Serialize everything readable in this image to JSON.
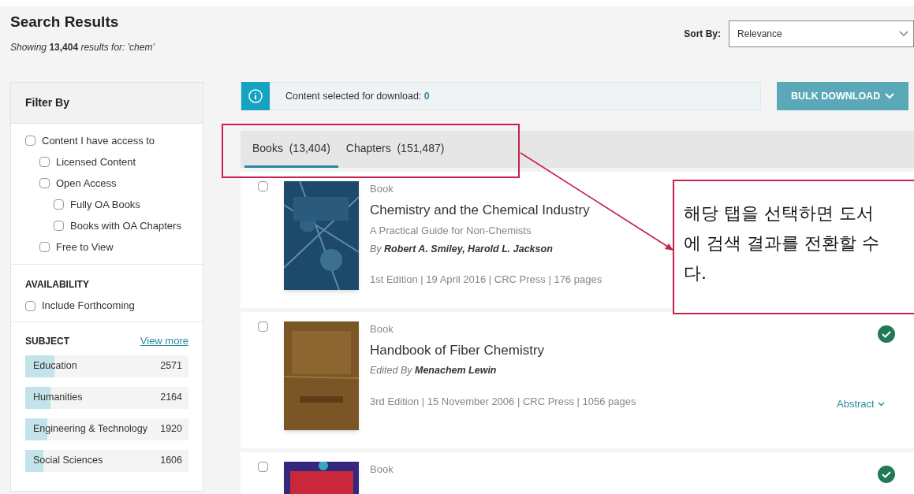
{
  "header": {
    "title": "Search Results",
    "summary": "*Showing* **13,404** *results for: 'chem'*"
  },
  "sort": {
    "label": "Sort By:",
    "value": "Relevance"
  },
  "sidebar": {
    "title": "Filter By",
    "access_filters": [
      {
        "label": "Content I have access to",
        "checked": false,
        "children": [
          {
            "label": "Licensed Content",
            "checked": false
          },
          {
            "label": "Open Access",
            "checked": false,
            "children": [
              {
                "label": "Fully OA Books",
                "checked": false
              },
              {
                "label": "Books with OA Chapters",
                "checked": false
              }
            ]
          },
          {
            "label": "Free to View",
            "checked": false
          }
        ]
      }
    ],
    "availability": {
      "heading": "AVAILABILITY",
      "options": [
        {
          "label": "Include Forthcoming",
          "checked": false
        }
      ]
    },
    "subject": {
      "heading": "SUBJECT",
      "link": "View more",
      "items": [
        {
          "name": "Education",
          "count": "2571",
          "level": 0.18
        },
        {
          "name": "Humanities",
          "count": "2164",
          "level": 0.155
        },
        {
          "name": "Engineering & Technology",
          "count": "1920",
          "level": 0.135
        },
        {
          "name": "Social Sciences",
          "count": "1606",
          "level": 0.11
        }
      ]
    }
  },
  "download": {
    "text": "Content selected for download:",
    "count": "0",
    "button": "BULK DOWNLOAD"
  },
  "tabs": [
    {
      "label": "Books",
      "count": "(13,404)",
      "selected": true
    },
    {
      "label": "Chapters",
      "count": "(151,487)",
      "selected": false
    }
  ],
  "results": [
    {
      "type": "Book",
      "title": "Chemistry and the Chemical Industry",
      "subtitle": "A Practical Guide for Non-Chemists",
      "byline": "By",
      "authors": "Robert A. Smiley, Harold L. Jackson",
      "meta": "1st Edition | 19 April 2016 | CRC Press | 176 pages",
      "checked": false
    },
    {
      "type": "Book",
      "title": "Handbook of Fiber Chemistry",
      "byline": "Edited By",
      "authors": "Menachem Lewin",
      "meta": "3rd Edition | 15 November 2006 | CRC Press | 1056 pages",
      "checked": false,
      "access": true,
      "abstract": "Abstract"
    },
    {
      "type": "Book",
      "checked": false,
      "access": true
    }
  ],
  "annotation": {
    "lines": [
      "해당 탭을 선택하면 도서",
      "에 검색 결과를 전환할 수",
      "다."
    ]
  }
}
